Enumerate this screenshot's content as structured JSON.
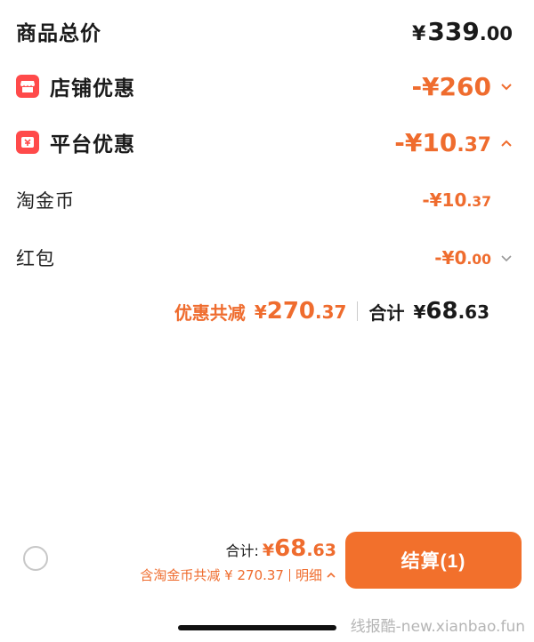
{
  "goods_total": {
    "label": "商品总价",
    "currency": "¥",
    "int": "339",
    "dec": ".00"
  },
  "store_discount": {
    "label": "店铺优惠",
    "prefix": "-¥",
    "int": "260",
    "dec": "",
    "icon": "shop-icon"
  },
  "platform_discount": {
    "label": "平台优惠",
    "prefix": "-¥",
    "int": "10",
    "dec": ".37",
    "icon": "coupon-icon"
  },
  "taojinbi": {
    "label": "淘金币",
    "prefix": "-¥",
    "int": "10",
    "dec": ".37"
  },
  "hongbao": {
    "label": "红包",
    "prefix": "-¥",
    "int": "0",
    "dec": ".00"
  },
  "summary": {
    "discount_label": "优惠共减",
    "discount_currency": "¥",
    "discount_int": "270",
    "discount_dec": ".37",
    "total_label": "合计",
    "total_currency": "¥",
    "total_int": "68",
    "total_dec": ".63"
  },
  "bottom": {
    "total_label": "合计:",
    "total_currency": "¥",
    "total_int": "68",
    "total_dec": ".63",
    "sub_text": "含淘金币共减 ¥ 270.37",
    "detail_label": "明细",
    "checkout_label": "结算(1)"
  },
  "watermark": "线报酷-new.xianbao.fun",
  "colors": {
    "accent": "#f2702c",
    "discount_text": "#ef6c2e",
    "badge": "#ff4a4a"
  }
}
